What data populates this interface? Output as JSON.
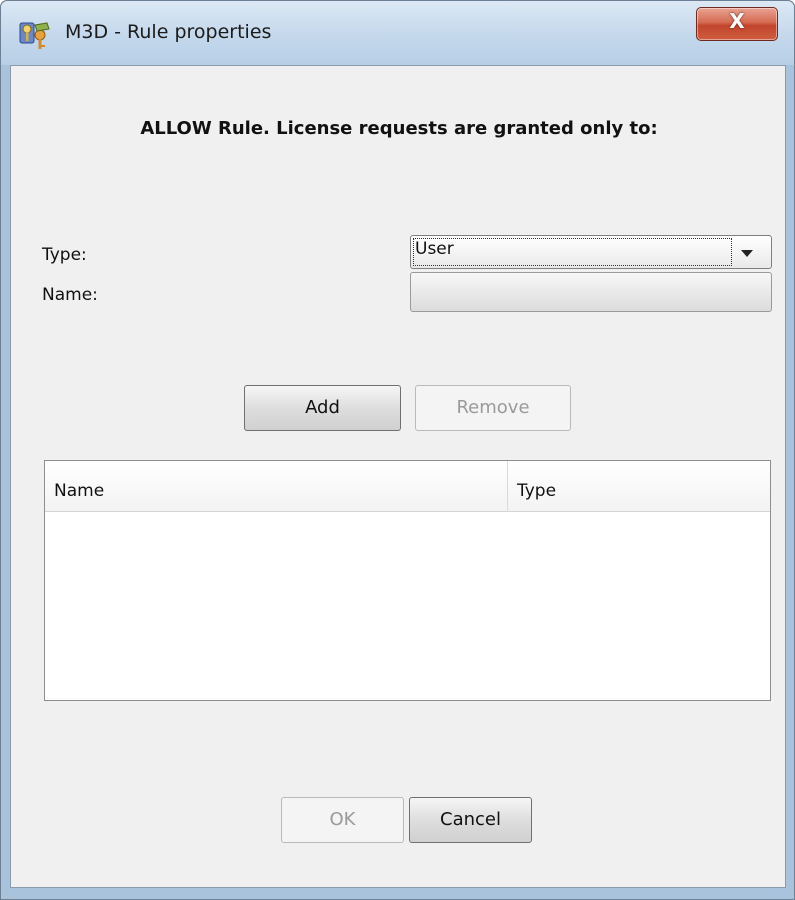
{
  "window": {
    "title": "M3D - Rule properties",
    "app_icon": "keys-app-icon",
    "close_label": "X"
  },
  "dialog": {
    "heading": "ALLOW Rule. License requests are granted only to:",
    "type_label": "Type:",
    "name_label": "Name:",
    "type_selected": "User",
    "name_value": ""
  },
  "buttons": {
    "add": "Add",
    "remove": "Remove",
    "ok": "OK",
    "cancel": "Cancel"
  },
  "table": {
    "columns": [
      "Name",
      "Type"
    ],
    "rows": []
  },
  "colors": {
    "titlebar": "#c4d8ec",
    "close_button": "#c2452c",
    "dialog_background": "#f0f0f0"
  }
}
